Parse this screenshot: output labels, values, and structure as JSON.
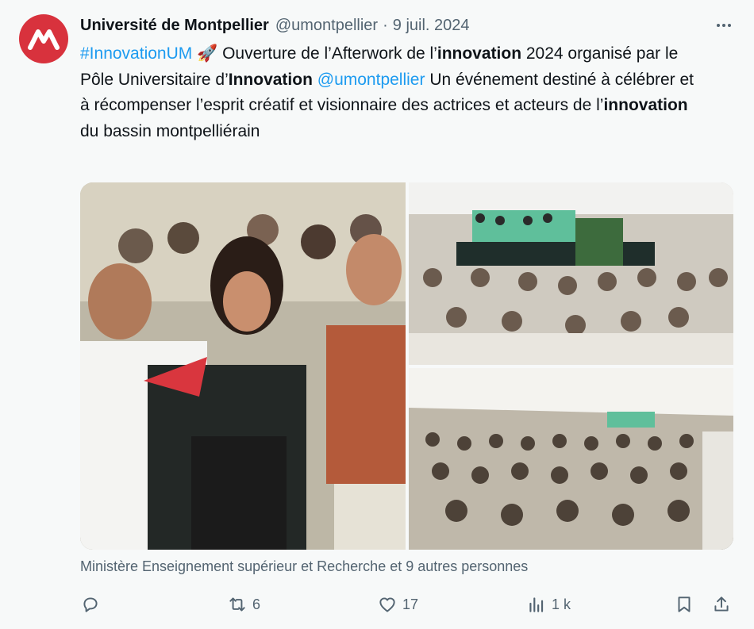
{
  "author": {
    "name": "Université de Montpellier",
    "handle": "@umontpellier",
    "separator": "·",
    "date": "9 juil. 2024"
  },
  "tweet": {
    "hashtag": "#InnovationUM",
    "rocket": "🚀",
    "t1": " Ouverture de l’Afterwork de l’",
    "b1": "innovation",
    "t2": " 2024 organisé par le Pôle Universitaire d’",
    "b2": "Innovation",
    "t3": " ",
    "mention": "@umontpellier",
    "t4": " Un événement destiné à célébrer et à récompenser l’esprit créatif et visionnaire des actrices et acteurs de l’",
    "b3": "innovation",
    "t5": " du bassin montpelliérain"
  },
  "likes_text": "Ministère Enseignement supérieur et Recherche et 9 autres personnes",
  "actions": {
    "reply_count": "",
    "retweet_count": "6",
    "like_count": "17",
    "views_count": "1 k"
  },
  "icons": {
    "more": "more-icon",
    "reply": "reply-icon",
    "retweet": "retweet-icon",
    "like": "heart-icon",
    "views": "views-icon",
    "bookmark": "bookmark-icon",
    "share": "share-icon"
  },
  "colors": {
    "brand": "#d8323d",
    "link": "#1d9bf0",
    "secondary_text": "#536471",
    "background": "#f7f9f9"
  }
}
